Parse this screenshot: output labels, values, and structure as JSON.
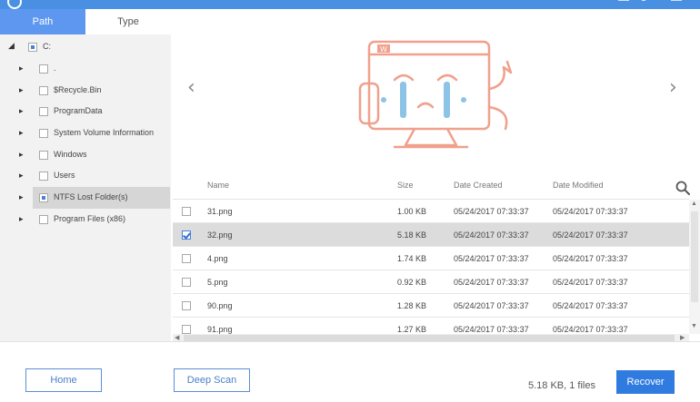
{
  "tabs": [
    {
      "label": "Path",
      "active": true
    },
    {
      "label": "Type",
      "active": false
    }
  ],
  "tree": {
    "root": {
      "label": "C:",
      "state": "partial"
    },
    "items": [
      {
        "label": ".",
        "checked": false,
        "selected": false
      },
      {
        "label": "$Recycle.Bin",
        "checked": false,
        "selected": false
      },
      {
        "label": "ProgramData",
        "checked": false,
        "selected": false
      },
      {
        "label": "System Volume Information",
        "checked": false,
        "selected": false
      },
      {
        "label": "Windows",
        "checked": false,
        "selected": false
      },
      {
        "label": "Users",
        "checked": false,
        "selected": false
      },
      {
        "label": "NTFS Lost Folder(s)",
        "checked": "partial",
        "selected": true
      },
      {
        "label": "Program Files (x86)",
        "checked": false,
        "selected": false
      }
    ]
  },
  "table": {
    "columns": [
      "Name",
      "Size",
      "Date Created",
      "Date Modified"
    ],
    "rows": [
      {
        "name": "31.png",
        "size": "1.00 KB",
        "created": "05/24/2017 07:33:37",
        "modified": "05/24/2017 07:33:37",
        "checked": false
      },
      {
        "name": "32.png",
        "size": "5.18 KB",
        "created": "05/24/2017 07:33:37",
        "modified": "05/24/2017 07:33:37",
        "checked": true
      },
      {
        "name": "4.png",
        "size": "1.74 KB",
        "created": "05/24/2017 07:33:37",
        "modified": "05/24/2017 07:33:37",
        "checked": false
      },
      {
        "name": "5.png",
        "size": "0.92 KB",
        "created": "05/24/2017 07:33:37",
        "modified": "05/24/2017 07:33:37",
        "checked": false
      },
      {
        "name": "90.png",
        "size": "1.28 KB",
        "created": "05/24/2017 07:33:37",
        "modified": "05/24/2017 07:33:37",
        "checked": false
      },
      {
        "name": "91.png",
        "size": "1.27 KB",
        "created": "05/24/2017 07:33:37",
        "modified": "05/24/2017 07:33:37",
        "checked": false
      }
    ]
  },
  "footer": {
    "home_label": "Home",
    "deep_scan_label": "Deep Scan",
    "status": "5.18 KB, 1 files",
    "recover_label": "Recover"
  },
  "icons": {
    "preview_prev": "chevron-left-icon",
    "preview_next": "chevron-right-icon",
    "search": "search-icon",
    "illustration": "crying-monitor-icon"
  },
  "colors": {
    "accent": "#2f7be0",
    "tab_active": "#5d97f0",
    "illustration": "#f0a08c",
    "tears": "#8cc4e8"
  }
}
